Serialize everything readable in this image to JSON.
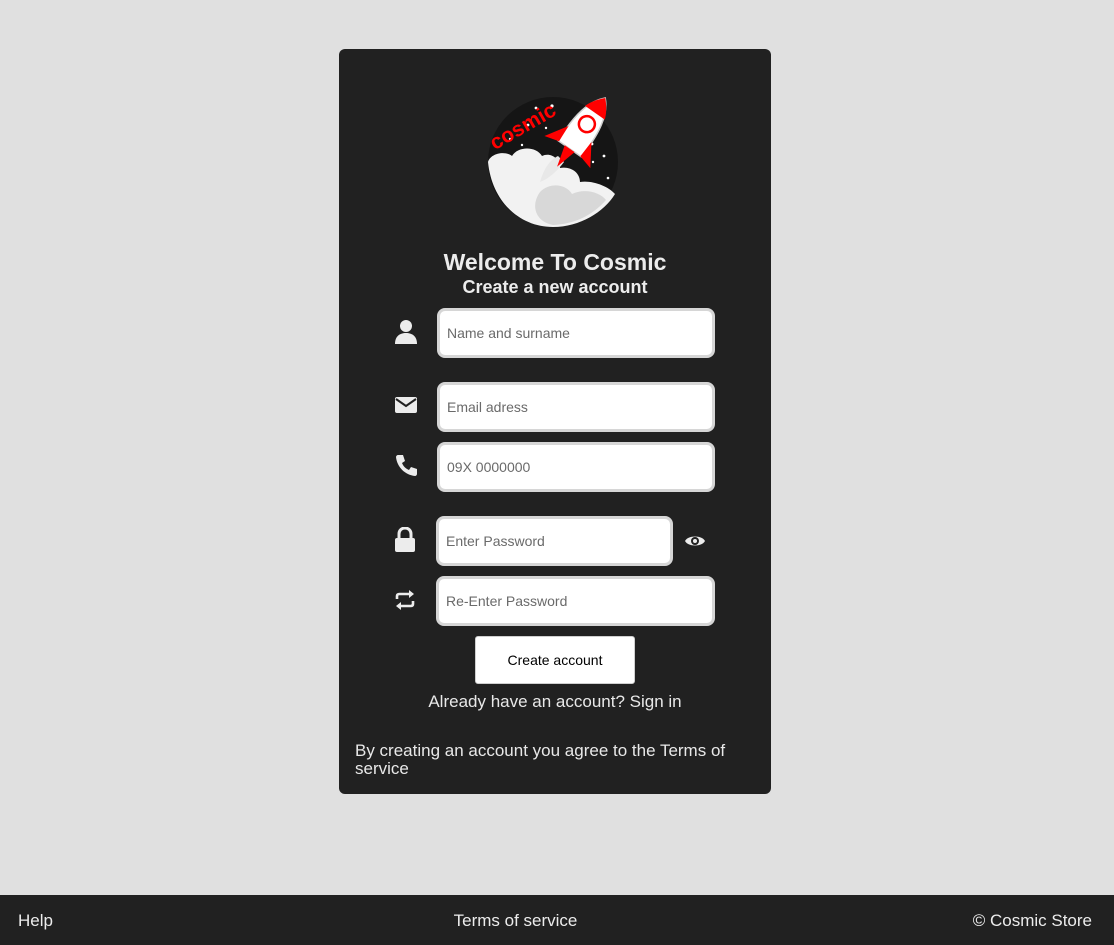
{
  "brand": {
    "logo_text": "cosmic",
    "accent": "#ff0000"
  },
  "header": {
    "title": "Welcome To Cosmic",
    "subtitle": "Create a new account"
  },
  "form": {
    "name_placeholder": "Name and surname",
    "email_placeholder": "Email adress",
    "phone_placeholder": "09X 0000000",
    "password_placeholder": "Enter Password",
    "repassword_placeholder": "Re-Enter Password",
    "submit_label": "Create account",
    "signin_text": "Already have an account? Sign in",
    "terms_text": "By creating an account you agree to the Terms of service"
  },
  "icons": [
    "user-icon",
    "envelope-icon",
    "phone-icon",
    "lock-icon",
    "eye-icon",
    "repeat-icon"
  ],
  "footer": {
    "help": "Help",
    "terms": "Terms of service",
    "copyright": "© Cosmic Store"
  }
}
